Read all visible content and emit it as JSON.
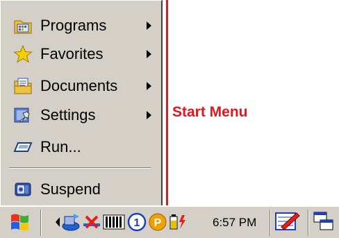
{
  "start_menu": {
    "items": [
      {
        "label": "Programs",
        "has_submenu": true
      },
      {
        "label": "Favorites",
        "has_submenu": true
      },
      {
        "label": "Documents",
        "has_submenu": true
      },
      {
        "label": "Settings",
        "has_submenu": true
      },
      {
        "label": "Run...",
        "has_submenu": false
      },
      {
        "label": "Suspend",
        "has_submenu": false
      }
    ]
  },
  "annotation": {
    "label": "Start Menu",
    "color": "#e8141c"
  },
  "taskbar": {
    "clock": "6:57 PM",
    "tray_icons": [
      "scroll-left-arrow-icon",
      "network-icon",
      "no-connection-icon",
      "battery-meter-icon",
      "profile-1-icon",
      "parking-p-icon",
      "battery-charging-icon"
    ]
  },
  "colors": {
    "chrome": "#d4d0c8",
    "accent_red": "#e8141c"
  }
}
